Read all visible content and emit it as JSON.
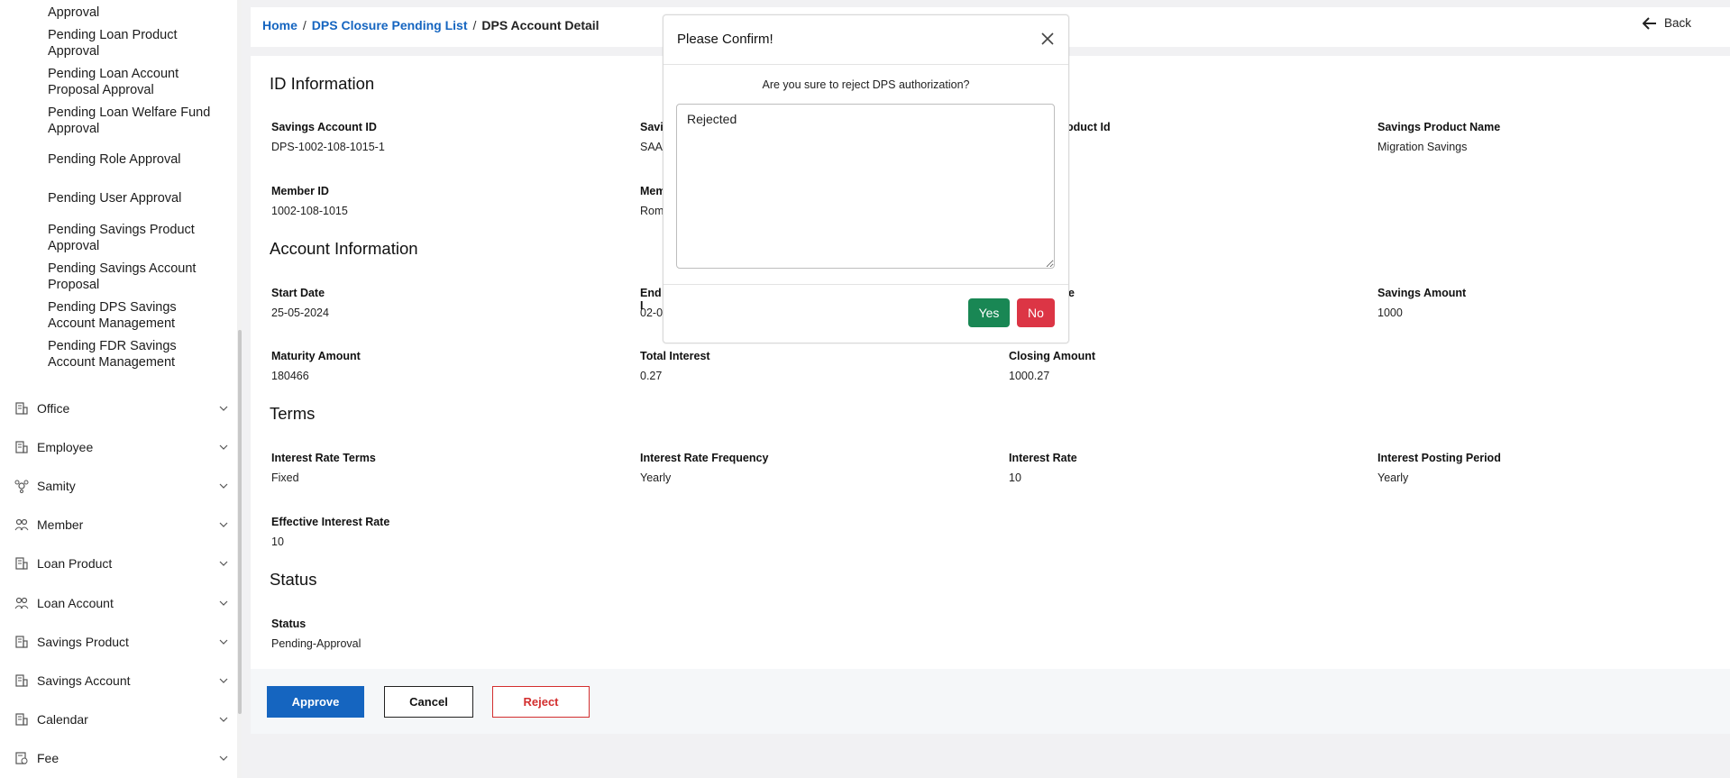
{
  "sidebar": {
    "sub_items": [
      {
        "line1": "Approval",
        "line2": ""
      },
      {
        "line1": "Pending Loan Product",
        "line2": "Approval"
      },
      {
        "line1": "Pending Loan Account",
        "line2": "Proposal Approval"
      },
      {
        "line1": "Pending Loan Welfare Fund",
        "line2": "Approval"
      },
      {
        "line1": "Pending Role Approval",
        "line2": ""
      },
      {
        "line1": "Pending User Approval",
        "line2": ""
      },
      {
        "line1": "Pending Savings Product",
        "line2": "Approval"
      },
      {
        "line1": "Pending Savings Account",
        "line2": "Proposal"
      },
      {
        "line1": "Pending DPS Savings",
        "line2": "Account Management"
      },
      {
        "line1": "Pending FDR Savings",
        "line2": "Account Management"
      }
    ],
    "nav_items": [
      {
        "label": "Office",
        "icon": "building-icon"
      },
      {
        "label": "Employee",
        "icon": "building-icon"
      },
      {
        "label": "Samity",
        "icon": "group-icon"
      },
      {
        "label": "Member",
        "icon": "users-icon"
      },
      {
        "label": "Loan Product",
        "icon": "building-icon"
      },
      {
        "label": "Loan Account",
        "icon": "users-icon"
      },
      {
        "label": "Savings Product",
        "icon": "building-icon"
      },
      {
        "label": "Savings Account",
        "icon": "building-icon"
      },
      {
        "label": "Calendar",
        "icon": "building-icon"
      },
      {
        "label": "Fee",
        "icon": "fee-icon"
      }
    ]
  },
  "breadcrumb": {
    "home": "Home",
    "list": "DPS Closure Pending List",
    "current": "DPS Account Detail",
    "sep": "/"
  },
  "header": {
    "back_label": "Back"
  },
  "sections": {
    "id_info": "ID Information",
    "account_info": "Account Information",
    "terms": "Terms",
    "status": "Status"
  },
  "fields": {
    "savings_account_id": {
      "label": "Savings Account ID",
      "value": "DPS-1002-108-1015-1"
    },
    "savings_col2": {
      "label": "Savi",
      "value": "SAA-"
    },
    "product_id": {
      "label": "oduct Id",
      "value": ""
    },
    "savings_product_name": {
      "label": "Savings Product Name",
      "value": "Migration Savings"
    },
    "member_id": {
      "label": "Member ID",
      "value": "1002-108-1015"
    },
    "member_col2": {
      "label": "Mem",
      "value": "Rom"
    },
    "start_date": {
      "label": "Start Date",
      "value": "25-05-2024"
    },
    "end_date": {
      "label": "End I",
      "value": "02-0"
    },
    "col3_account": {
      "label": "e",
      "value": ""
    },
    "savings_amount": {
      "label": "Savings Amount",
      "value": "1000"
    },
    "maturity_amount": {
      "label": "Maturity Amount",
      "value": "180466"
    },
    "total_interest": {
      "label": "Total Interest",
      "value": "0.27"
    },
    "closing_amount": {
      "label": "Closing Amount",
      "value": "1000.27"
    },
    "interest_rate_terms": {
      "label": "Interest Rate Terms",
      "value": "Fixed"
    },
    "interest_rate_frequency": {
      "label": "Interest Rate Frequency",
      "value": "Yearly"
    },
    "interest_rate": {
      "label": "Interest Rate",
      "value": "10"
    },
    "interest_posting_period": {
      "label": "Interest Posting Period",
      "value": "Yearly"
    },
    "effective_interest_rate": {
      "label": "Effective Interest Rate",
      "value": "10"
    },
    "status": {
      "label": "Status",
      "value": "Pending-Approval"
    }
  },
  "actions": {
    "approve": "Approve",
    "cancel": "Cancel",
    "reject": "Reject"
  },
  "modal": {
    "title": "Please Confirm!",
    "message": "Are you sure to reject DPS authorization?",
    "text_value": "Rejected",
    "yes": "Yes",
    "no": "No"
  },
  "colors": {
    "primary": "#1565c0",
    "danger": "#dc3545",
    "success": "#198754"
  }
}
